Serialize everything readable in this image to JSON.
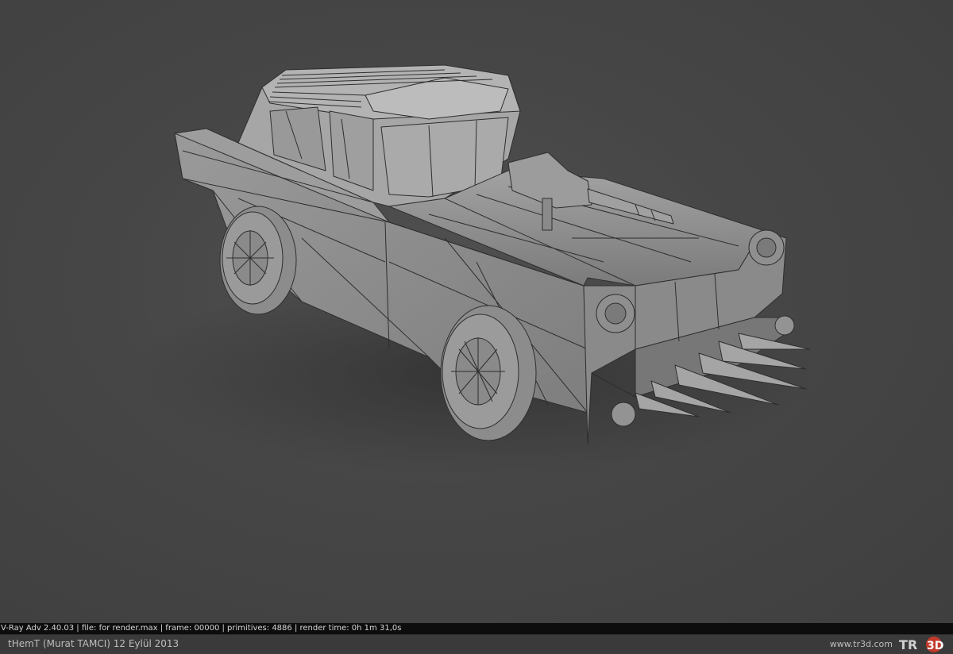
{
  "render": {
    "subject": "3D wireframe car with roof-mounted gun and front spikes",
    "stamp": "V-Ray Adv 2.40.03 | file: for render.max | frame: 00000 | primitives: 4886 | render time:  0h  1m 31,0s"
  },
  "footer": {
    "author": "tHemT (Murat TAMCI)   12 Eylül 2013",
    "site": "www.tr3d.com",
    "logo_text": "TR3D",
    "logo_accent": "#c0392b"
  },
  "colors": {
    "background": "#444444",
    "model": "#8d8d8d",
    "wire": "#2e2e2e"
  }
}
